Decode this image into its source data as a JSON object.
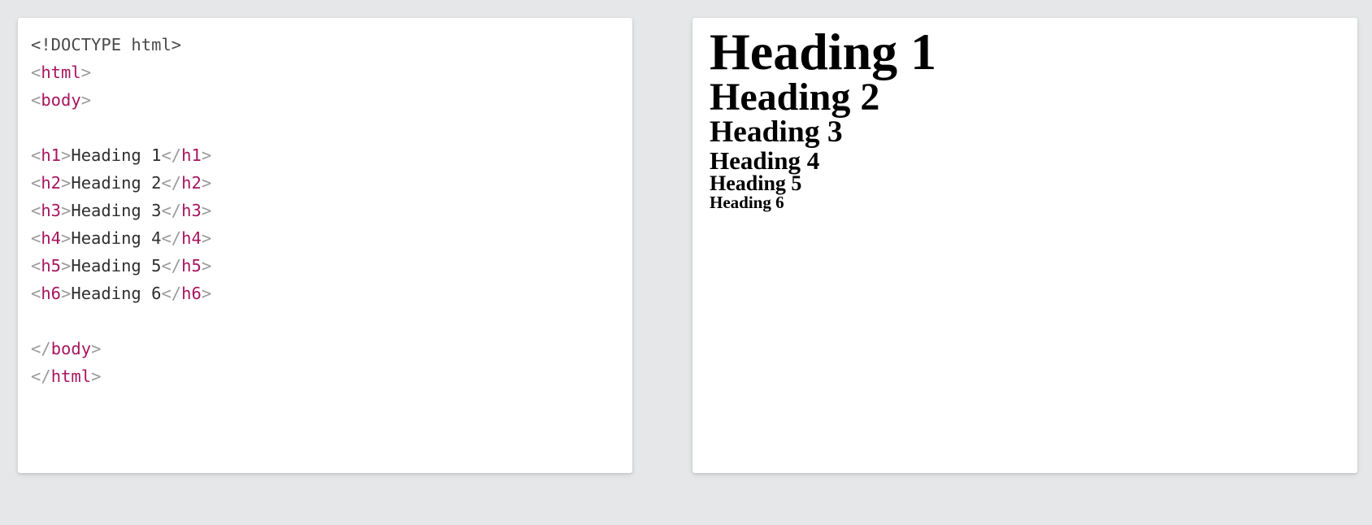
{
  "page": {
    "background_color": "#e6e7e9",
    "panel_background_color": "#ffffff"
  },
  "code_panel": {
    "name": "html-source-code",
    "language": "html",
    "colors": {
      "punctuation": "#9a9a9a",
      "tag_name": "#a8155e",
      "text_content": "#2f2f2f",
      "doctype": "#4a4a4a"
    },
    "lines": [
      {
        "index": 0,
        "tokens": [
          {
            "type": "doctype",
            "text": "<!DOCTYPE html>"
          }
        ]
      },
      {
        "index": 1,
        "tokens": [
          {
            "type": "punct",
            "text": "<"
          },
          {
            "type": "tag",
            "text": "html"
          },
          {
            "type": "punct",
            "text": ">"
          }
        ]
      },
      {
        "index": 2,
        "tokens": [
          {
            "type": "punct",
            "text": "<"
          },
          {
            "type": "tag",
            "text": "body"
          },
          {
            "type": "punct",
            "text": ">"
          }
        ]
      },
      {
        "index": 3,
        "tokens": []
      },
      {
        "index": 4,
        "tokens": [
          {
            "type": "punct",
            "text": "<"
          },
          {
            "type": "tag",
            "text": "h1"
          },
          {
            "type": "punct",
            "text": ">"
          },
          {
            "type": "text",
            "text": "Heading 1"
          },
          {
            "type": "punct",
            "text": "</"
          },
          {
            "type": "tag",
            "text": "h1"
          },
          {
            "type": "punct",
            "text": ">"
          }
        ]
      },
      {
        "index": 5,
        "tokens": [
          {
            "type": "punct",
            "text": "<"
          },
          {
            "type": "tag",
            "text": "h2"
          },
          {
            "type": "punct",
            "text": ">"
          },
          {
            "type": "text",
            "text": "Heading 2"
          },
          {
            "type": "punct",
            "text": "</"
          },
          {
            "type": "tag",
            "text": "h2"
          },
          {
            "type": "punct",
            "text": ">"
          }
        ]
      },
      {
        "index": 6,
        "tokens": [
          {
            "type": "punct",
            "text": "<"
          },
          {
            "type": "tag",
            "text": "h3"
          },
          {
            "type": "punct",
            "text": ">"
          },
          {
            "type": "text",
            "text": "Heading 3"
          },
          {
            "type": "punct",
            "text": "</"
          },
          {
            "type": "tag",
            "text": "h3"
          },
          {
            "type": "punct",
            "text": ">"
          }
        ]
      },
      {
        "index": 7,
        "tokens": [
          {
            "type": "punct",
            "text": "<"
          },
          {
            "type": "tag",
            "text": "h4"
          },
          {
            "type": "punct",
            "text": ">"
          },
          {
            "type": "text",
            "text": "Heading 4"
          },
          {
            "type": "punct",
            "text": "</"
          },
          {
            "type": "tag",
            "text": "h4"
          },
          {
            "type": "punct",
            "text": ">"
          }
        ]
      },
      {
        "index": 8,
        "tokens": [
          {
            "type": "punct",
            "text": "<"
          },
          {
            "type": "tag",
            "text": "h5"
          },
          {
            "type": "punct",
            "text": ">"
          },
          {
            "type": "text",
            "text": "Heading 5"
          },
          {
            "type": "punct",
            "text": "</"
          },
          {
            "type": "tag",
            "text": "h5"
          },
          {
            "type": "punct",
            "text": ">"
          }
        ]
      },
      {
        "index": 9,
        "tokens": [
          {
            "type": "punct",
            "text": "<"
          },
          {
            "type": "tag",
            "text": "h6"
          },
          {
            "type": "punct",
            "text": ">"
          },
          {
            "type": "text",
            "text": "Heading 6"
          },
          {
            "type": "punct",
            "text": "</"
          },
          {
            "type": "tag",
            "text": "h6"
          },
          {
            "type": "punct",
            "text": ">"
          }
        ]
      },
      {
        "index": 10,
        "tokens": []
      },
      {
        "index": 11,
        "tokens": [
          {
            "type": "punct",
            "text": "</"
          },
          {
            "type": "tag",
            "text": "body"
          },
          {
            "type": "punct",
            "text": ">"
          }
        ]
      },
      {
        "index": 12,
        "tokens": [
          {
            "type": "punct",
            "text": "</"
          },
          {
            "type": "tag",
            "text": "html"
          },
          {
            "type": "punct",
            "text": ">"
          }
        ]
      }
    ]
  },
  "render_panel": {
    "name": "rendered-html-preview",
    "headings": [
      {
        "level": 1,
        "text": "Heading 1"
      },
      {
        "level": 2,
        "text": "Heading 2"
      },
      {
        "level": 3,
        "text": "Heading 3"
      },
      {
        "level": 4,
        "text": "Heading 4"
      },
      {
        "level": 5,
        "text": "Heading 5"
      },
      {
        "level": 6,
        "text": "Heading 6"
      }
    ]
  }
}
